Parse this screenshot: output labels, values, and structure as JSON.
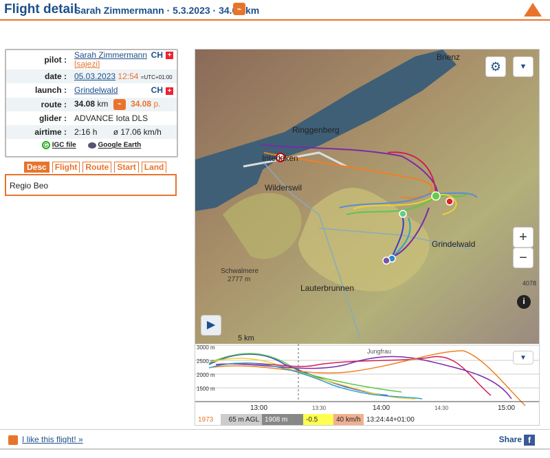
{
  "header": {
    "title": "Flight detail",
    "subtitle": "Sarah Zimmermann · 5.3.2023 · 34.08 km",
    "logo_icon": "route-type-icon",
    "brand_icon": "xcontest-logo-icon"
  },
  "info": {
    "pilot_label": "pilot :",
    "pilot_name": "Sarah Zimmermann",
    "pilot_nick": "[sajezi]",
    "pilot_country": "CH",
    "date_label": "date :",
    "date": "05.03.2023",
    "time": "12:54",
    "utc": "=UTC+01:00",
    "launch_label": "launch :",
    "launch": "Grindelwald",
    "launch_country": "CH",
    "route_label": "route :",
    "route_km": "34.08",
    "route_km_unit": "km",
    "route_points": "34.08",
    "route_points_unit": "p.",
    "glider_label": "glider :",
    "glider": "ADVANCE Iota DLS",
    "airtime_label": "airtime :",
    "airtime": "2:16 h",
    "avg_speed": "ø 17.06 km/h",
    "igc_label": "IGC file",
    "ge_label": "Google Earth"
  },
  "tabs": [
    {
      "label": "Desc",
      "active": true
    },
    {
      "label": "Flight",
      "active": false
    },
    {
      "label": "Route",
      "active": false
    },
    {
      "label": "Start",
      "active": false
    },
    {
      "label": "Land",
      "active": false
    }
  ],
  "description": "Regio Beo",
  "map": {
    "places": [
      "Brienz",
      "Ringgenberg",
      "Interlaken",
      "Wilderswil",
      "Grindelwald",
      "Lauterbrunnen",
      "Schwalmere",
      "Jungfrau"
    ],
    "peak_label": "Schwalmere",
    "peak_alt": "2777 m",
    "peak2_alt": "4078",
    "scale": "5 km",
    "zoom_in": "+",
    "zoom_out": "−",
    "info_btn": "i"
  },
  "profile": {
    "y_ticks": [
      "3000 m",
      "2500 m",
      "2000 m",
      "1500 m"
    ],
    "x_ticks": [
      "13:00",
      "13:30",
      "14:00",
      "14:30",
      "15:00"
    ],
    "place_label": "Jungfrau"
  },
  "status": {
    "alt": "1973 m",
    "agl": "65 m AGL",
    "gnd": "1908 m GND",
    "vario": "-0.5 m/s",
    "speed": "40 km/h",
    "time": "13:24:44+01:00"
  },
  "footer": {
    "like": "I like this flight! »",
    "share": "Share"
  },
  "colors": {
    "accent": "#e8742c",
    "brand": "#1d4f8a",
    "lake": "#3f5f76"
  }
}
